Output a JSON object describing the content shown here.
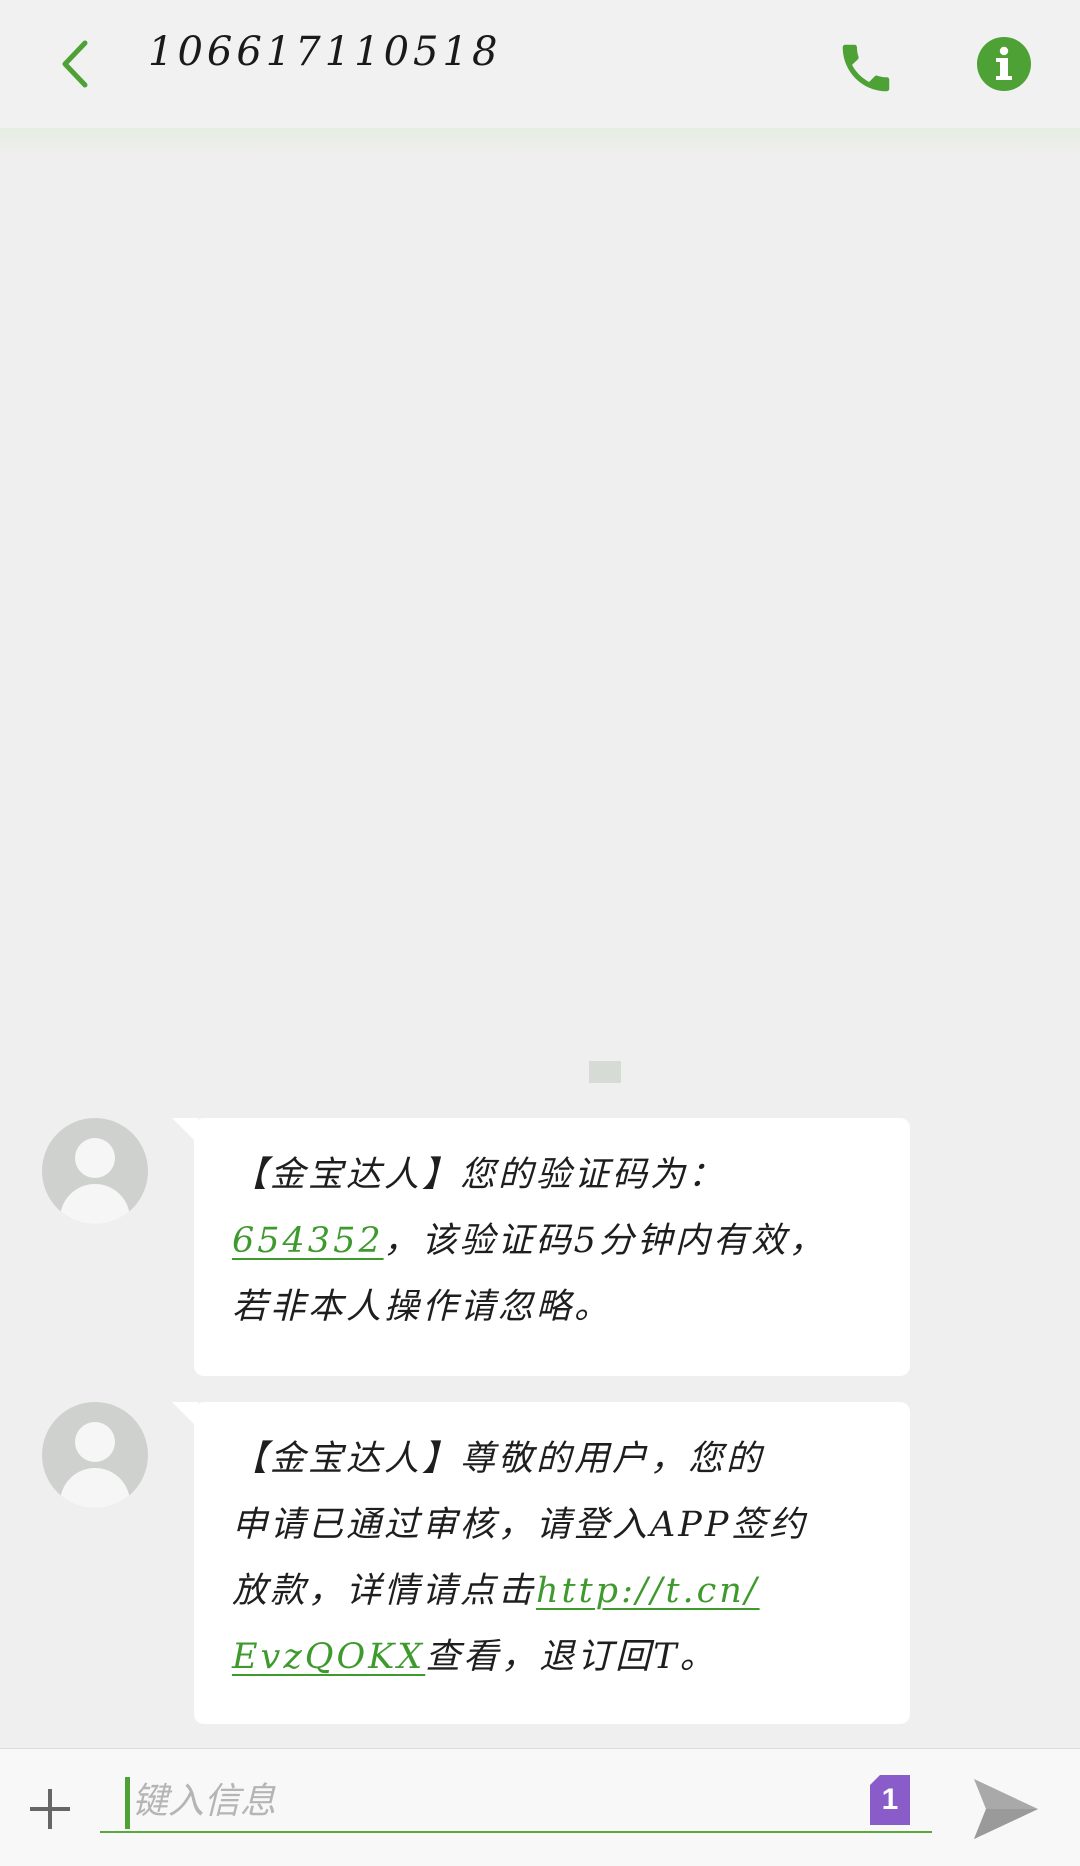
{
  "header": {
    "title": "106617110518",
    "back_icon": "chevron-left-icon",
    "call_icon": "phone-icon",
    "info_icon": "info-icon"
  },
  "messages": [
    {
      "line1": "【金宝达人】您的验证码为：",
      "code": "654352",
      "line2_rest": "，该验证码5分钟内有效，",
      "line3": "若非本人操作请忽略。"
    },
    {
      "line1": "【金宝达人】尊敬的用户，您的",
      "line2": "申请已通过审核，请登入APP签约",
      "line3_text": "放款，详情请点击",
      "link_part1": "http://t.cn/",
      "link_part2": "EvzQOKX",
      "line4_rest": "查看，退订回T。"
    }
  ],
  "composer": {
    "placeholder": "键入信息",
    "sim_badge": "1",
    "add_icon": "plus-icon",
    "send_icon": "send-icon"
  },
  "colors": {
    "accent": "#4ea135",
    "link": "#3f9a2e",
    "sim_badge": "#8a5cc9",
    "background": "#efefef",
    "bubble": "#ffffff"
  }
}
